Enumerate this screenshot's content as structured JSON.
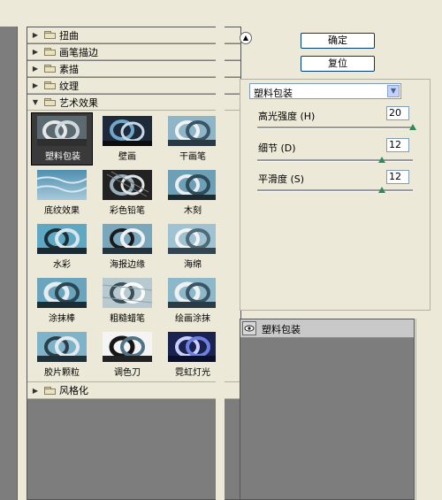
{
  "categories_top": [
    {
      "label": "扭曲",
      "expanded": false
    },
    {
      "label": "画笔描边",
      "expanded": false
    },
    {
      "label": "素描",
      "expanded": false
    },
    {
      "label": "纹理",
      "expanded": false
    },
    {
      "label": "艺术效果",
      "expanded": true
    }
  ],
  "filters": [
    "塑料包装",
    "壁画",
    "干画笔",
    "底纹效果",
    "彩色铅笔",
    "木刻",
    "水彩",
    "海报边缘",
    "海绵",
    "涂抹棒",
    "粗糙蜡笔",
    "绘画涂抹",
    "胶片颗粒",
    "调色刀",
    "霓虹灯光"
  ],
  "selected_filter": "塑料包装",
  "category_bottom": {
    "label": "风格化",
    "expanded": false
  },
  "buttons": {
    "ok": "确定",
    "reset": "复位"
  },
  "filter_select": {
    "value": "塑料包装"
  },
  "params": {
    "highlight": {
      "label": "高光强度 (H)",
      "value": "20",
      "level": 1.0
    },
    "detail": {
      "label": "细节 (D)",
      "value": "12",
      "level": 0.8
    },
    "smoothness": {
      "label": "平滑度 (S)",
      "value": "12",
      "level": 0.8
    }
  },
  "layers": [
    {
      "name": "塑料包装",
      "visible": true
    }
  ],
  "icons": {
    "collapse": "collapse-up-icon",
    "eye": "eye-icon",
    "folder": "folder-icon"
  }
}
